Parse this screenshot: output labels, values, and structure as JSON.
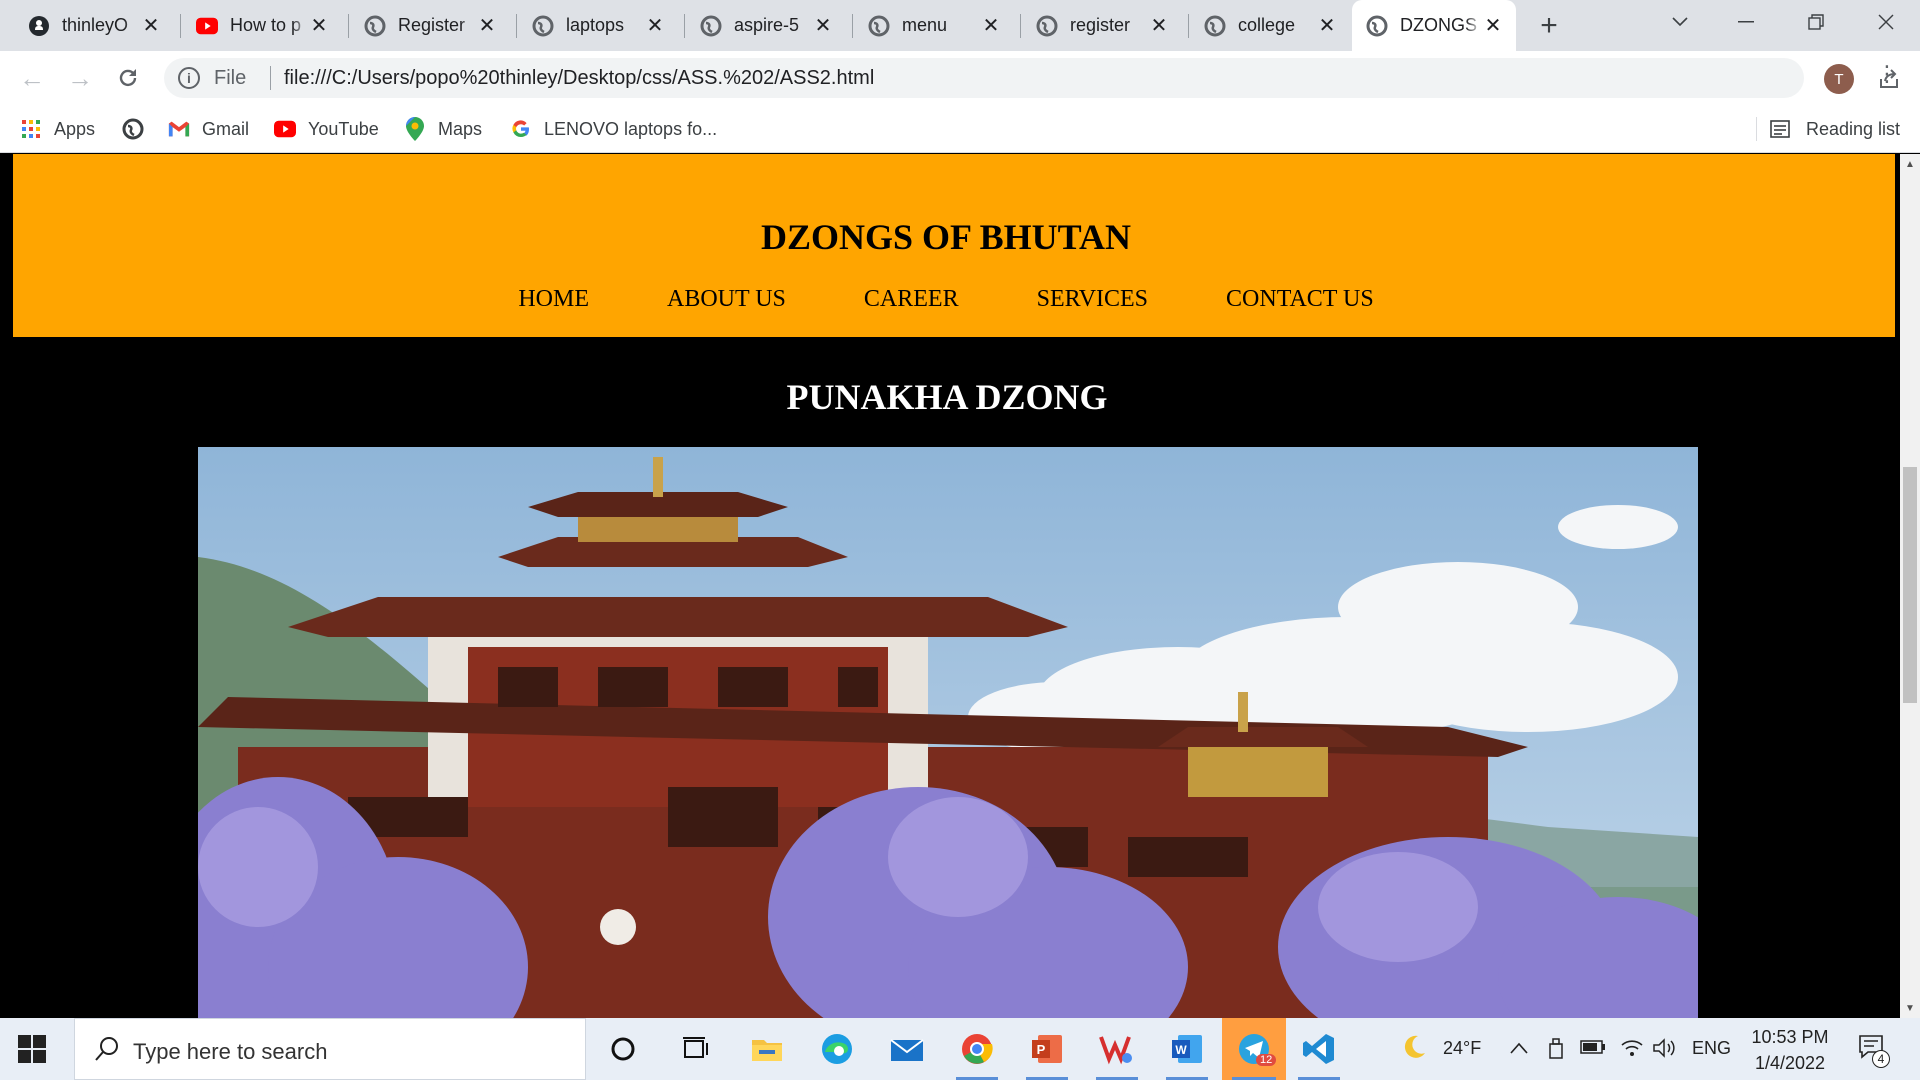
{
  "browser": {
    "tabs": [
      {
        "title": "thinleyO",
        "icon": "github-icon"
      },
      {
        "title": "How to p",
        "icon": "youtube-icon"
      },
      {
        "title": "Register",
        "icon": "globe-icon"
      },
      {
        "title": "laptops",
        "icon": "globe-icon"
      },
      {
        "title": "aspire-5",
        "icon": "globe-icon"
      },
      {
        "title": "menu",
        "icon": "globe-icon"
      },
      {
        "title": "register",
        "icon": "globe-icon"
      },
      {
        "title": "college",
        "icon": "globe-icon"
      },
      {
        "title": "DZONGS",
        "icon": "globe-icon",
        "active": true
      }
    ],
    "omnibox": {
      "scheme_label": "File",
      "url": "file:///C:/Users/popo%20thinley/Desktop/css/ASS.%202/ASS2.html"
    },
    "profile_initial": "T",
    "bookmarks": [
      {
        "label": "Apps",
        "icon": "apps-grid-icon"
      },
      {
        "label": "",
        "icon": "globe-icon"
      },
      {
        "label": "Gmail",
        "icon": "gmail-icon"
      },
      {
        "label": "YouTube",
        "icon": "youtube-icon"
      },
      {
        "label": "Maps",
        "icon": "maps-pin-icon"
      },
      {
        "label": "LENOVO laptops fo...",
        "icon": "google-icon"
      }
    ],
    "reading_list_label": "Reading list"
  },
  "page": {
    "site_title": "DZONGS OF BHUTAN",
    "nav": [
      "HOME",
      "ABOUT US",
      "CAREER",
      "SERVICES",
      "CONTACT US"
    ],
    "section_title": "PUNAKHA DZONG",
    "colors": {
      "header_bg": "#ffa500",
      "page_bg": "#000000",
      "heading_on_dark": "#ffffff"
    }
  },
  "taskbar": {
    "search_placeholder": "Type here to search",
    "apps": [
      "cortana-icon",
      "task-view-icon",
      "file-explorer-icon",
      "edge-icon",
      "mail-icon",
      "chrome-icon",
      "powerpoint-icon",
      "wps-icon",
      "word-icon",
      "telegram-icon",
      "vscode-icon"
    ],
    "telegram_badge": "12",
    "weather": "24°F",
    "language": "ENG",
    "time": "10:53 PM",
    "date": "1/4/2022",
    "notification_count": "4"
  }
}
